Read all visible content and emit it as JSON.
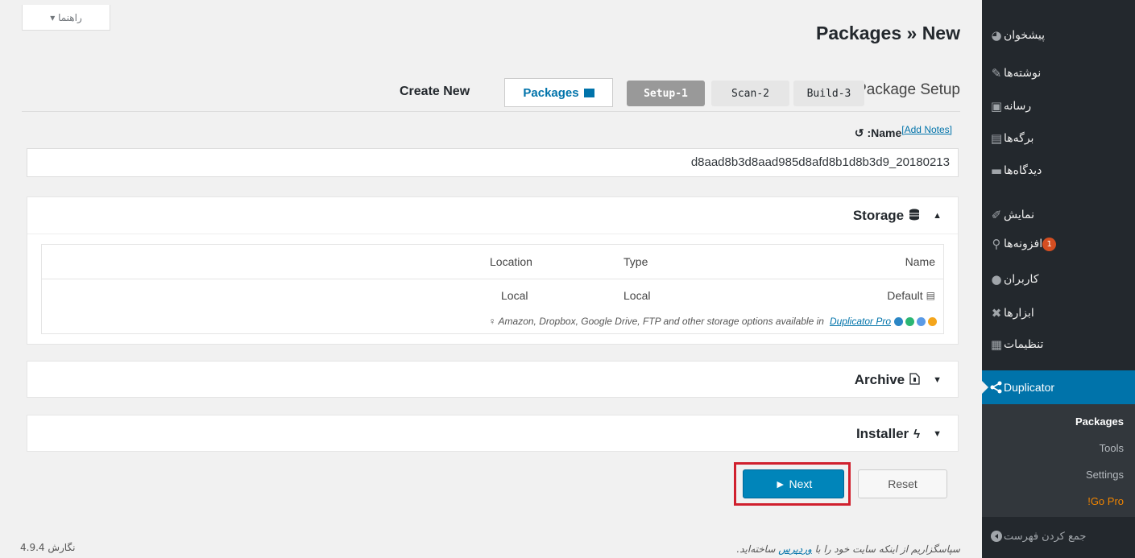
{
  "sidebar": {
    "items": [
      {
        "label": "پیشخوان",
        "icon": "dashboard-icon"
      },
      {
        "label": "نوشته‌ها",
        "icon": "pin-icon"
      },
      {
        "label": "رسانه",
        "icon": "media-icon"
      },
      {
        "label": "برگه‌ها",
        "icon": "pages-icon"
      },
      {
        "label": "دیدگاه‌ها",
        "icon": "comments-icon"
      },
      {
        "label": "نمایش",
        "icon": "appearance-icon"
      },
      {
        "label": "افزونه‌ها",
        "icon": "plugins-icon",
        "badge": "1"
      },
      {
        "label": "کاربران",
        "icon": "users-icon"
      },
      {
        "label": "ابزارها",
        "icon": "tools-icon"
      },
      {
        "label": "تنظیمات",
        "icon": "settings-icon"
      },
      {
        "label": "Duplicator",
        "icon": "share-icon"
      }
    ],
    "submenu": [
      "Packages",
      "Tools",
      "Settings",
      "!Go Pro"
    ],
    "collapse_label": "جمع کردن فهرست"
  },
  "help_tab": {
    "label": "راهنما ▾"
  },
  "page_title": "Packages » New",
  "setup": {
    "title": "Package Setup",
    "steps": [
      "Setup-1",
      "Scan-2",
      "Build-3"
    ],
    "packages_button": "Packages",
    "create_new": "Create New"
  },
  "name_field": {
    "label": ":Name",
    "add_notes": "[Add Notes]",
    "value": "d8aad8b3d8aad985d8afd8b1d8b3d9_20180213"
  },
  "storage": {
    "title": "Storage",
    "headers": {
      "name": "Name",
      "type": "Type",
      "location": "Location"
    },
    "row": {
      "name": "Default",
      "type": "Local",
      "location": "Local"
    },
    "note": "Amazon, Dropbox, Google Drive, FTP and other storage options available in",
    "note_link": "Duplicator Pro"
  },
  "archive": {
    "title": "Archive"
  },
  "installer": {
    "title": "Installer"
  },
  "buttons": {
    "next": "► Next",
    "reset": "Reset"
  },
  "footer": {
    "version": "نگارش 4.9.4",
    "thanks_prefix": "سپاسگزاریم از اینکه سایت خود را با",
    "thanks_link": "وردپرس",
    "thanks_suffix": "ساخته‌اید."
  },
  "colors": {
    "sidebar_bg": "#23282d",
    "accent": "#0073aa",
    "primary_button": "#0085ba",
    "highlight": "#d0202e"
  }
}
